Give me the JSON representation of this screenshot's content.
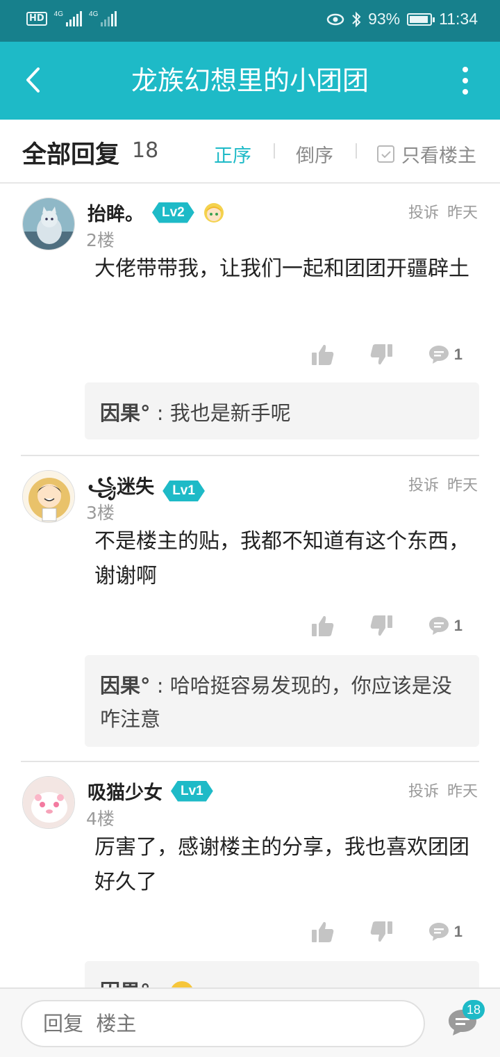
{
  "status_bar": {
    "hd": "HD",
    "network_1": "4G",
    "network_2": "4G",
    "battery": "93%",
    "battery_level": 0.93,
    "time": "11:34"
  },
  "app_bar": {
    "title": "龙族幻想里的小团团"
  },
  "filter": {
    "title": "全部回复",
    "count": "18",
    "sort_asc": "正序",
    "sort_desc": "倒序",
    "only_op": "只看楼主"
  },
  "replies": [
    {
      "user": "抬眸。",
      "level": "Lv2",
      "floor": "2楼",
      "report": "投诉",
      "time": "昨天",
      "content": "大佬带带我，让我们一起和团团开疆辟土",
      "comment_count": "1",
      "sub_reply": {
        "user": "因果°",
        "sep": " : ",
        "text": "我也是新手呢"
      }
    },
    {
      "user": "꧁迷失",
      "level": "Lv1",
      "floor": "3楼",
      "report": "投诉",
      "time": "昨天",
      "content": "不是楼主的贴，我都不知道有这个东西，谢谢啊",
      "comment_count": "1",
      "sub_reply": {
        "user": "因果°",
        "sep": " : ",
        "text": "哈哈挺容易发现的，你应该是没咋注意"
      }
    },
    {
      "user": "吸猫少女",
      "level": "Lv1",
      "floor": "4楼",
      "report": "投诉",
      "time": "昨天",
      "content": "厉害了，感谢楼主的分享，我也喜欢团团好久了",
      "comment_count": "1",
      "sub_reply": {
        "user": "因果°",
        "sep": " : ",
        "text": ""
      }
    }
  ],
  "bottom_bar": {
    "placeholder": "回复  楼主",
    "comment_badge": "18"
  },
  "colors": {
    "status_bar": "#17808c",
    "accent": "#1ebac7"
  }
}
